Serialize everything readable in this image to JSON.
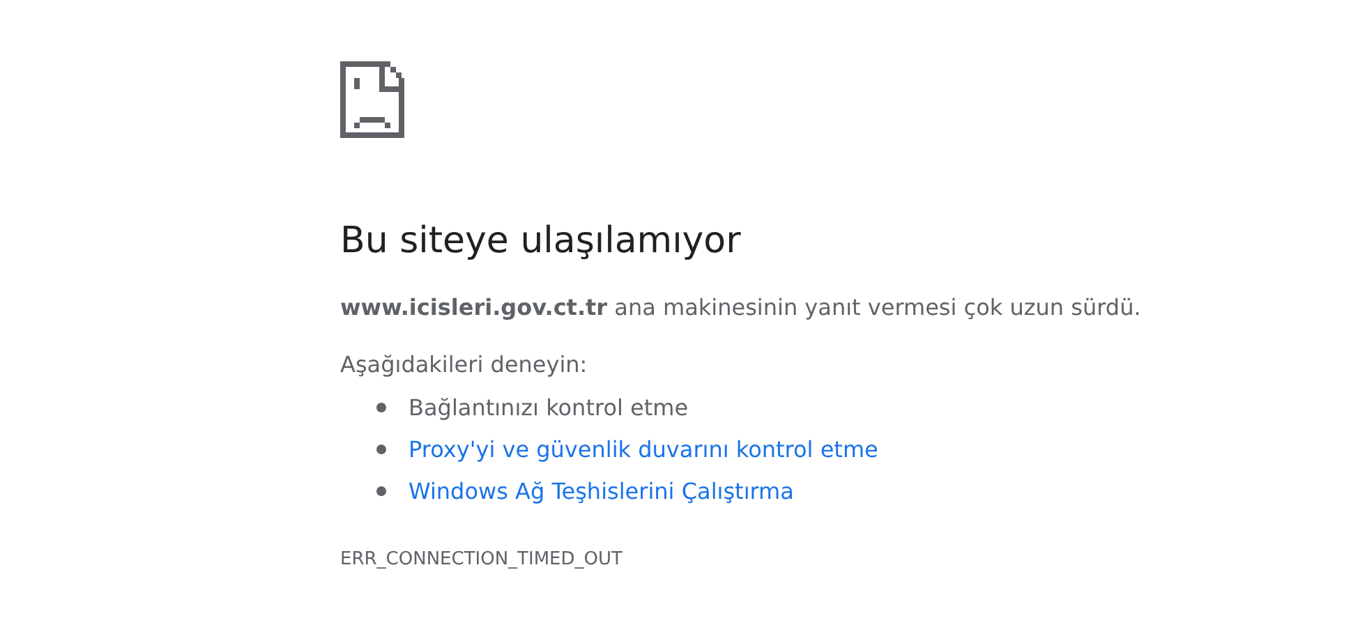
{
  "heading": "Bu siteye ulaşılamıyor",
  "message": "**www.icisleri.gov.ct.tr** ana makinesinin yanıt vermesi çok uzun sürdü.",
  "suggestions_title": "Aşağıdakileri deneyin:",
  "suggestions": [
    {
      "kind": "text",
      "label": "Bağlantınızı kontrol etme"
    },
    {
      "kind": "link",
      "label": "Proxy'yi ve güvenlik duvarını kontrol etme"
    },
    {
      "kind": "link",
      "label": "Windows Ağ Teşhislerini Çalıştırma"
    }
  ],
  "error_code": "ERR_CONNECTION_TIMED_OUT"
}
